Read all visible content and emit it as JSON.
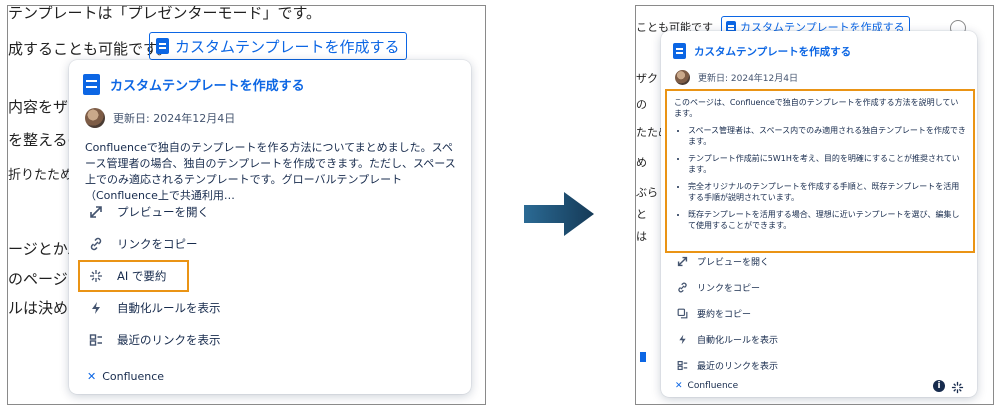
{
  "left": {
    "background_lines": [
      "テンプレートは「プレゼンターモード」です。",
      "成することも可能です。",
      "内容をザク",
      "を整えるの",
      "折りたため",
      "ージとかぶら",
      "のページと",
      "ルは決め"
    ],
    "inline_link": "カスタムテンプレートを作成する",
    "card": {
      "title": "カスタムテンプレートを作成する",
      "updated": "更新日: 2024年12月4日",
      "description": "Confluenceで独自のテンプレートを作る方法についてまとめました。スペース管理者の場合、独自のテンプレートを作成できます。ただし、スペース上でのみ適応されるテンプレートです。グローバルテンプレート（Confluence上で共通利用…",
      "menu": [
        {
          "icon": "expand-icon",
          "label": "プレビューを開く"
        },
        {
          "icon": "link-icon",
          "label": "リンクをコピー"
        },
        {
          "icon": "ai-sparkle-icon",
          "label": "AI で要約"
        },
        {
          "icon": "lightning-icon",
          "label": "自動化ルールを表示"
        },
        {
          "icon": "recent-links-icon",
          "label": "最近のリンクを表示"
        }
      ],
      "footer": "Confluence"
    }
  },
  "right": {
    "background_lines": [
      "ことも可能です",
      "ザク",
      "の",
      "たため",
      "め",
      "ぶら",
      "と",
      "は"
    ],
    "inline_link": "カスタムテンプレートを作成する",
    "card": {
      "title": "カスタムテンプレートを作成する",
      "updated": "更新日: 2024年12月4日",
      "summary_intro": "このページは、Confluenceで独自のテンプレートを作成する方法を説明しています。",
      "summary_points": [
        "スペース管理者は、スペース内でのみ適用される独自テンプレートを作成できます。",
        "テンプレート作成前に5W1Hを考え、目的を明確にすることが推奨されています。",
        "完全オリジナルのテンプレートを作成する手順と、既存テンプレートを活用する手順が説明されています。",
        "既存テンプレートを活用する場合、理想に近いテンプレートを選び、編集して使用することができます。"
      ],
      "menu": [
        {
          "icon": "expand-icon",
          "label": "プレビューを開く"
        },
        {
          "icon": "link-icon",
          "label": "リンクをコピー"
        },
        {
          "icon": "copy-icon",
          "label": "要約をコピー"
        },
        {
          "icon": "lightning-icon",
          "label": "自動化ルールを表示"
        },
        {
          "icon": "recent-links-icon",
          "label": "最近のリンクを表示"
        }
      ],
      "footer": "Confluence"
    }
  },
  "colors": {
    "accent": "#0c66e4",
    "highlight": "#ea9415",
    "arrow": "#1d4f73"
  }
}
